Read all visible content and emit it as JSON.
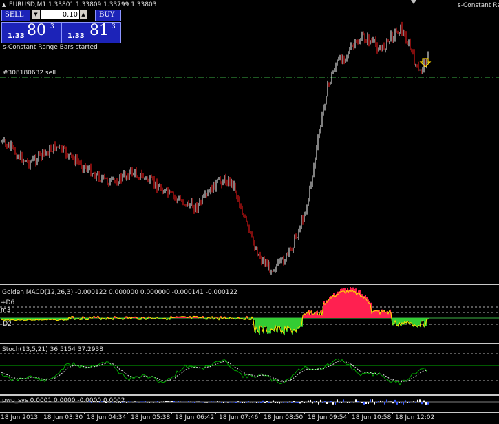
{
  "header": {
    "symbol_line": "EURUSD,M1  1.33801 1.33809 1.33799 1.33803",
    "indicator_right": "s-Constant Ran",
    "started_msg": "s-Constant Range Bars started"
  },
  "trade_panel": {
    "sell_label": "SELL",
    "buy_label": "BUY",
    "lot_value": "0.10",
    "sell_price_prefix": "1.33",
    "sell_price_big": "80",
    "sell_price_sup": "3",
    "buy_price_prefix": "1.33",
    "buy_price_big": "81",
    "buy_price_sup": "3"
  },
  "order_line": {
    "label": "#308180632 sell"
  },
  "macd": {
    "label": "Golden MACD(12,26,3) -0.000122 0.000000 0.000000 -0.000141 -0.000122",
    "level_d6": "+D6",
    "level_m3": "m3",
    "level_d2": "-D2"
  },
  "stoch": {
    "label": "Stoch(13,5,21) 36.5154 37.2938"
  },
  "pwo": {
    "label": "pwo_sys 0.0001 0.0000 -0.0000 0.0002"
  },
  "time_axis": [
    "18 Jun 2013",
    "18 Jun 03:30",
    "18 Jun 04:34",
    "18 Jun 05:38",
    "18 Jun 06:42",
    "18 Jun 07:46",
    "18 Jun 08:50",
    "18 Jun 09:54",
    "18 Jun 10:58",
    "18 Jun 12:02"
  ],
  "colors": {
    "background": "#000000",
    "bull_bar": "#ffffff",
    "bear_bar": "#ff1a1a",
    "order_line": "#3cb043",
    "panel_blue": "#1c23b8",
    "macd_pos": "#ff2050",
    "macd_neg": "#33cc33",
    "stoch_main": "#00aa00",
    "level_line": "#b0b0b0",
    "arrow": "#ffd700"
  },
  "chart_data": {
    "type": "line",
    "series": [
      {
        "values": [
          0.58,
          0.55,
          0.5,
          0.47,
          0.5,
          0.53,
          0.56,
          0.52,
          0.48,
          0.45,
          0.41,
          0.38,
          0.36,
          0.39,
          0.42,
          0.4,
          0.37,
          0.34,
          0.3,
          0.27,
          0.25,
          0.23,
          0.28,
          0.35,
          0.38,
          0.36,
          0.2,
          0.05,
          -0.05,
          -0.1,
          -0.08,
          -0.02,
          0.1,
          0.25,
          0.55,
          0.85,
          1.0,
          1.05,
          1.1,
          1.15,
          1.12,
          1.08,
          1.15,
          1.2,
          1.1,
          0.95,
          1.05
        ]
      }
    ]
  }
}
